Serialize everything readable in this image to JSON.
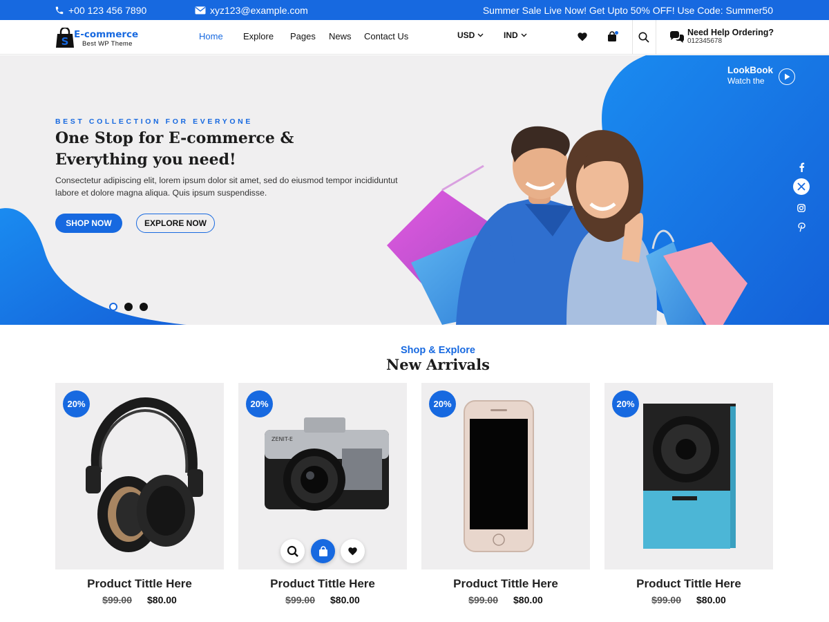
{
  "topbar": {
    "phone": "+00 123 456 7890",
    "email": "xyz123@example.com",
    "promo": "Summer Sale Live Now! Get Upto 50% OFF! Use Code: Summer50"
  },
  "header": {
    "logo_title": "E-commerce",
    "logo_subtitle": "Best WP Theme",
    "nav": [
      "Home",
      "Explore",
      "Pages",
      "News",
      "Contact Us"
    ],
    "active_nav": "Home",
    "currency": "USD",
    "region": "IND",
    "help_title": "Need Help Ordering?",
    "help_phone": "012345678"
  },
  "hero": {
    "eyebrow": "BEST COLLECTION FOR EVERYONE",
    "headline": "One Stop for E-commerce & Everything you need!",
    "description": "Consectetur adipiscing elit, lorem ipsum dolor sit amet, sed do eiusmod tempor incididuntut labore et dolore magna aliqua. Quis ipsum suspendisse.",
    "primary_button": "SHOP NOW",
    "secondary_button": "EXPLORE NOW",
    "lookbook_title": "LookBook",
    "lookbook_subtitle": "Watch the",
    "active_slide": 1,
    "slide_count": 3,
    "social": [
      "facebook-icon",
      "x-twitter-icon",
      "instagram-icon",
      "pinterest-icon"
    ]
  },
  "arrivals": {
    "subtitle": "Shop & Explore",
    "title": "New Arrivals",
    "products": [
      {
        "badge": "20%",
        "title": "Product Tittle Here",
        "old_price": "$99.00",
        "price": "$80.00",
        "image": "headphones"
      },
      {
        "badge": "20%",
        "title": "Product Tittle Here",
        "old_price": "$99.00",
        "price": "$80.00",
        "image": "camera"
      },
      {
        "badge": "20%",
        "title": "Product Tittle Here",
        "old_price": "$99.00",
        "price": "$80.00",
        "image": "smartphone"
      },
      {
        "badge": "20%",
        "title": "Product Tittle Here",
        "old_price": "$99.00",
        "price": "$80.00",
        "image": "speaker"
      }
    ]
  },
  "colors": {
    "accent": "#1769e0",
    "hero_background": "#f0eff0",
    "card_background": "#efeeef"
  }
}
